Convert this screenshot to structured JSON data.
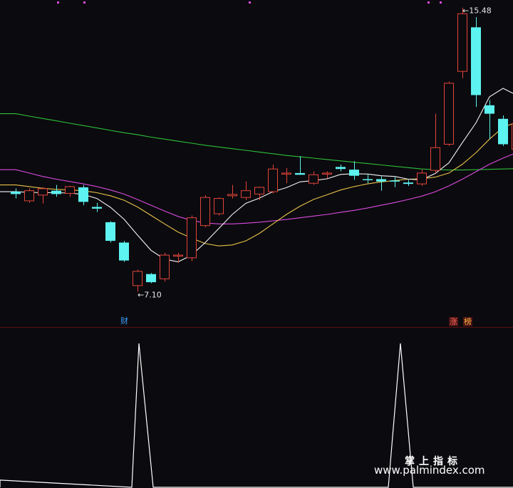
{
  "chart_data": [
    {
      "type": "candlestick",
      "ylim": [
        6.5,
        15.6
      ],
      "colors": {
        "up": "#e3453a",
        "down": "#5cf3f0",
        "ma5": "#f5f5f5",
        "ma10": "#e8c24a",
        "ma20": "#d94be0",
        "ma60": "#2fbf3a"
      },
      "candles": [
        {
          "o": 10.05,
          "h": 10.15,
          "l": 9.85,
          "c": 9.98
        },
        {
          "o": 9.78,
          "h": 10.15,
          "l": 9.72,
          "c": 10.08
        },
        {
          "o": 9.95,
          "h": 10.18,
          "l": 9.7,
          "c": 10.14
        },
        {
          "o": 10.08,
          "h": 10.25,
          "l": 9.9,
          "c": 9.98
        },
        {
          "o": 10.0,
          "h": 10.22,
          "l": 9.9,
          "c": 10.2
        },
        {
          "o": 10.18,
          "h": 10.25,
          "l": 9.65,
          "c": 9.75
        },
        {
          "o": 9.6,
          "h": 9.72,
          "l": 9.45,
          "c": 9.55
        },
        {
          "o": 9.15,
          "h": 9.18,
          "l": 8.55,
          "c": 8.6
        },
        {
          "o": 8.55,
          "h": 8.6,
          "l": 7.98,
          "c": 8.02
        },
        {
          "o": 7.28,
          "h": 7.75,
          "l": 7.1,
          "c": 7.7
        },
        {
          "o": 7.62,
          "h": 7.65,
          "l": 7.35,
          "c": 7.38
        },
        {
          "o": 7.48,
          "h": 8.25,
          "l": 7.4,
          "c": 8.18
        },
        {
          "o": 8.15,
          "h": 8.25,
          "l": 7.95,
          "c": 8.18
        },
        {
          "o": 8.1,
          "h": 9.35,
          "l": 8.0,
          "c": 9.28
        },
        {
          "o": 9.05,
          "h": 9.95,
          "l": 9.0,
          "c": 9.88
        },
        {
          "o": 9.4,
          "h": 9.88,
          "l": 9.35,
          "c": 9.85
        },
        {
          "o": 9.93,
          "h": 10.25,
          "l": 9.85,
          "c": 9.97
        },
        {
          "o": 9.88,
          "h": 10.35,
          "l": 9.8,
          "c": 10.08
        },
        {
          "o": 9.98,
          "h": 10.2,
          "l": 9.8,
          "c": 10.18
        },
        {
          "o": 10.05,
          "h": 10.85,
          "l": 10.0,
          "c": 10.72
        },
        {
          "o": 10.58,
          "h": 10.75,
          "l": 10.3,
          "c": 10.6
        },
        {
          "o": 10.6,
          "h": 11.1,
          "l": 10.55,
          "c": 10.55
        },
        {
          "o": 10.3,
          "h": 10.65,
          "l": 10.25,
          "c": 10.55
        },
        {
          "o": 10.58,
          "h": 10.65,
          "l": 10.45,
          "c": 10.6
        },
        {
          "o": 10.78,
          "h": 10.85,
          "l": 10.65,
          "c": 10.72
        },
        {
          "o": 10.7,
          "h": 10.95,
          "l": 10.4,
          "c": 10.52
        },
        {
          "o": 10.42,
          "h": 10.55,
          "l": 10.3,
          "c": 10.4
        },
        {
          "o": 10.42,
          "h": 10.5,
          "l": 10.08,
          "c": 10.35
        },
        {
          "o": 10.38,
          "h": 10.48,
          "l": 10.18,
          "c": 10.35
        },
        {
          "o": 10.32,
          "h": 10.4,
          "l": 10.22,
          "c": 10.28
        },
        {
          "o": 10.28,
          "h": 10.7,
          "l": 10.22,
          "c": 10.6
        },
        {
          "o": 10.68,
          "h": 12.35,
          "l": 10.6,
          "c": 11.35
        },
        {
          "o": 11.45,
          "h": 13.3,
          "l": 11.4,
          "c": 13.25
        },
        {
          "o": 13.6,
          "h": 15.48,
          "l": 13.4,
          "c": 15.3
        },
        {
          "o": 14.9,
          "h": 15.2,
          "l": 12.55,
          "c": 12.9
        },
        {
          "o": 12.6,
          "h": 12.75,
          "l": 11.6,
          "c": 12.35
        },
        {
          "o": 12.2,
          "h": 12.3,
          "l": 11.4,
          "c": 11.45
        },
        {
          "o": 11.3,
          "h": 12.7,
          "l": 11.25,
          "c": 12.05
        }
      ],
      "ma5": [
        10.05,
        10.03,
        10.02,
        10.02,
        10.01,
        9.97,
        9.85,
        9.59,
        9.24,
        8.77,
        8.32,
        8.06,
        7.98,
        8.18,
        8.55,
        8.96,
        9.38,
        9.71,
        9.86,
        10.05,
        10.17,
        10.34,
        10.38,
        10.43,
        10.56,
        10.58,
        10.57,
        10.52,
        10.5,
        10.42,
        10.4,
        10.59,
        10.9,
        11.5,
        12.08,
        12.85,
        13.1,
        12.9
      ],
      "ma10": [
        10.25,
        10.2,
        10.15,
        10.12,
        10.1,
        10.08,
        10.02,
        9.93,
        9.8,
        9.6,
        9.35,
        9.1,
        8.86,
        8.68,
        8.52,
        8.45,
        8.48,
        8.6,
        8.82,
        9.1,
        9.38,
        9.62,
        9.82,
        9.96,
        10.1,
        10.2,
        10.28,
        10.34,
        10.38,
        10.42,
        10.43,
        10.48,
        10.6,
        10.86,
        11.2,
        11.6,
        11.95,
        12.1
      ],
      "ma20": [
        10.7,
        10.6,
        10.5,
        10.42,
        10.35,
        10.28,
        10.2,
        10.1,
        9.98,
        9.82,
        9.65,
        9.48,
        9.32,
        9.2,
        9.13,
        9.1,
        9.1,
        9.12,
        9.15,
        9.19,
        9.23,
        9.28,
        9.33,
        9.38,
        9.44,
        9.5,
        9.57,
        9.65,
        9.73,
        9.82,
        9.92,
        10.05,
        10.22,
        10.42,
        10.64,
        10.86,
        11.04,
        11.2
      ],
      "ma60": [
        12.35,
        12.28,
        12.21,
        12.14,
        12.07,
        12.0,
        11.93,
        11.86,
        11.79,
        11.73,
        11.66,
        11.6,
        11.54,
        11.48,
        11.42,
        11.37,
        11.32,
        11.27,
        11.22,
        11.17,
        11.12,
        11.08,
        11.04,
        11.0,
        10.96,
        10.92,
        10.88,
        10.84,
        10.8,
        10.76,
        10.72,
        10.7,
        10.69,
        10.69,
        10.7,
        10.71,
        10.72,
        10.73
      ],
      "annotations": [
        {
          "text": "←7.10",
          "candle": 9,
          "value": 7.1
        },
        {
          "text": "←15.48",
          "candle": 33,
          "value": 15.48
        }
      ]
    },
    {
      "type": "line",
      "ylim": [
        0,
        1
      ],
      "color": "#ffffff",
      "points": [
        [
          0.0,
          0.0
        ],
        [
          0.0,
          0.05
        ],
        [
          185,
          0.0
        ],
        [
          195,
          1.0
        ],
        [
          215,
          0.0
        ],
        [
          545,
          0.0
        ],
        [
          562,
          1.0
        ],
        [
          580,
          0.0
        ],
        [
          720,
          0.0
        ]
      ]
    }
  ],
  "badges": [
    {
      "text": "财",
      "bg": "#0b0a0e",
      "color": "#3fa0ff"
    },
    {
      "text": "涨",
      "bg": "#4a1414",
      "color": "#ff6a5a"
    },
    {
      "text": "榜",
      "bg": "#4a1414",
      "color": "#ffb23f"
    }
  ],
  "watermark": {
    "line1": "掌上指标",
    "line2": "www.palmindex.com"
  }
}
